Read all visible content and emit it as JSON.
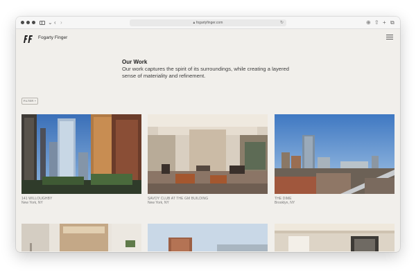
{
  "browser": {
    "url": "fogartyfinger.com",
    "icons": [
      "sidebar-icon",
      "back-icon",
      "forward-icon",
      "lock-icon",
      "reload-icon",
      "download-icon",
      "share-icon",
      "new-tab-icon",
      "tabs-icon"
    ]
  },
  "site": {
    "brand": "Fogarty Finger",
    "logo_text": "FF",
    "heading": "Our Work",
    "intro": "Our work captures the spirit of its surroundings, while creating a layered sense of materiality and refinement.",
    "filter_label": "FILTER +"
  },
  "projects": [
    {
      "name": "141 WILLOUGHBY",
      "location": "New York, NY"
    },
    {
      "name": "SAVOY CLUB AT THE GM BUILDING",
      "location": "New York, NY"
    },
    {
      "name": "THE DIME",
      "location": "Brooklyn, NY"
    }
  ],
  "colors": {
    "page_background": "#f1efeb",
    "text_dark": "#1e1e1e",
    "caption": "#777777"
  }
}
